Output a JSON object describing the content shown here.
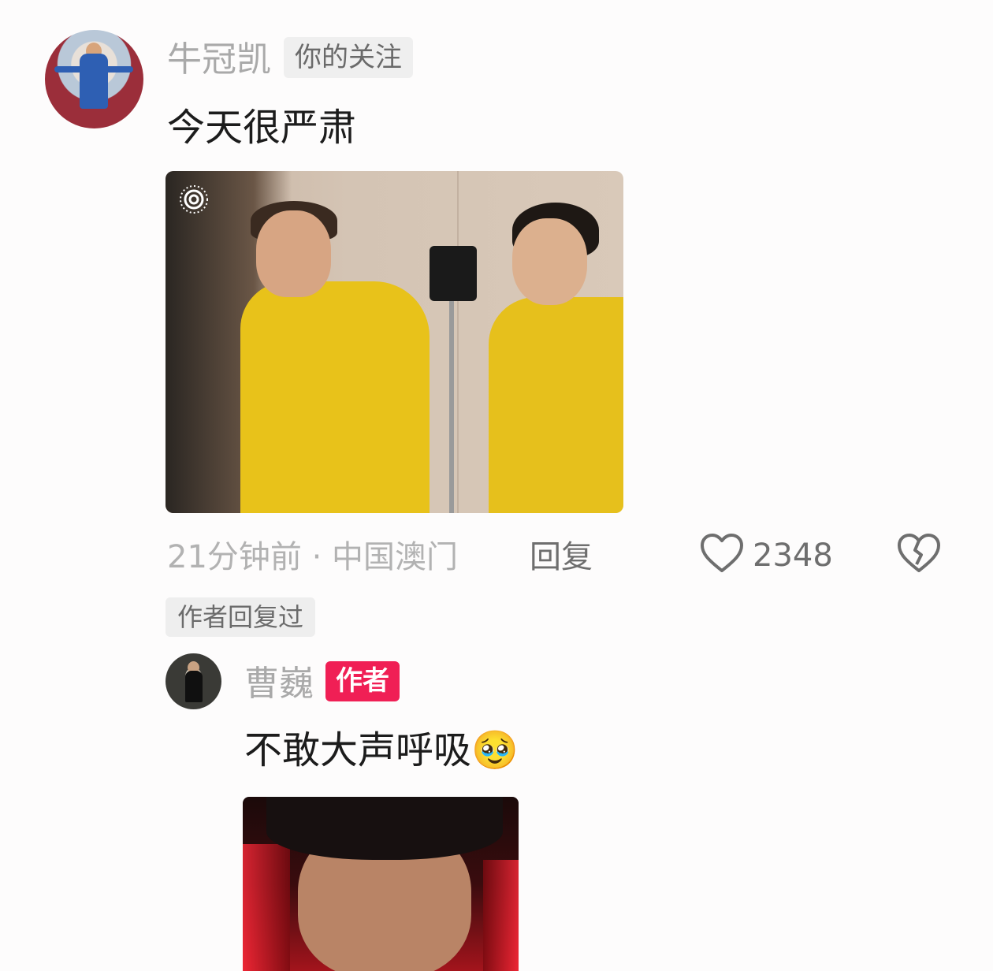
{
  "comment": {
    "username": "牛冠凯",
    "follow_badge": "你的关注",
    "text": "今天很严肃",
    "meta": "21分钟前 · 中国澳门",
    "reply_label": "回复",
    "like_count": "2348",
    "author_replied_tag": "作者回复过"
  },
  "reply": {
    "username": "曹巍",
    "author_badge": "作者",
    "text": "不敢大声呼吸",
    "emoji": "🥹"
  },
  "icons": {
    "like": "heart-outline-icon",
    "dislike": "broken-heart-icon",
    "live_photo": "live-photo-icon"
  },
  "colors": {
    "author_badge": "#f01f55",
    "muted_text": "#a9a9a9",
    "body_text": "#1c1c1c"
  }
}
